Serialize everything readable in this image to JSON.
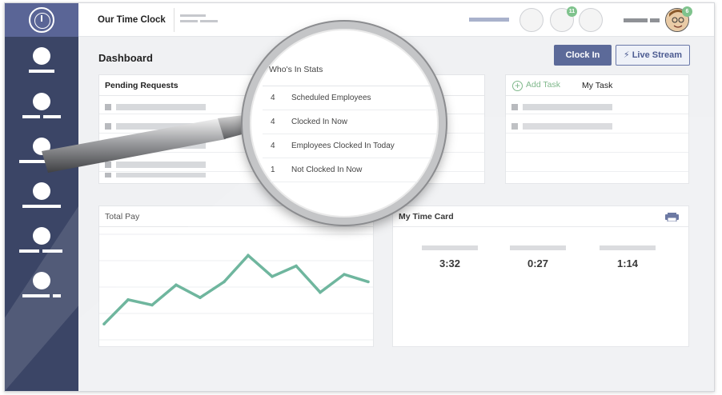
{
  "header": {
    "brand": "Our Time Clock",
    "notif_badge": "11",
    "avatar_badge": "6"
  },
  "main": {
    "title": "Dashboard",
    "clock_in_label": "Clock In",
    "live_stream_label": "Live Stream"
  },
  "pending": {
    "title": "Pending Requests"
  },
  "tasks": {
    "add_label": "Add Task",
    "my_task_label": "My Task"
  },
  "total_pay": {
    "title": "Total Pay"
  },
  "time_card": {
    "title": "My Time Card",
    "values": [
      "3:32",
      "0:27",
      "1:14"
    ]
  },
  "whos_in": {
    "title": "Who's In Stats",
    "rows": [
      {
        "count": "4",
        "label": "Scheduled Employees"
      },
      {
        "count": "4",
        "label": "Clocked In Now"
      },
      {
        "count": "4",
        "label": "Employees Clocked In Today"
      },
      {
        "count": "1",
        "label": "Not Clocked In Now"
      }
    ]
  },
  "colors": {
    "sidebar": "#3b4566",
    "accent": "#5c6a99",
    "chart_line": "#5fae94",
    "green": "#7fb88b"
  },
  "chart_data": {
    "type": "line",
    "series": [
      {
        "values": [
          0.15,
          0.38,
          0.33,
          0.52,
          0.4,
          0.55,
          0.8,
          0.6,
          0.7,
          0.45,
          0.62,
          0.55
        ]
      }
    ],
    "ylim": [
      0,
      1
    ]
  }
}
